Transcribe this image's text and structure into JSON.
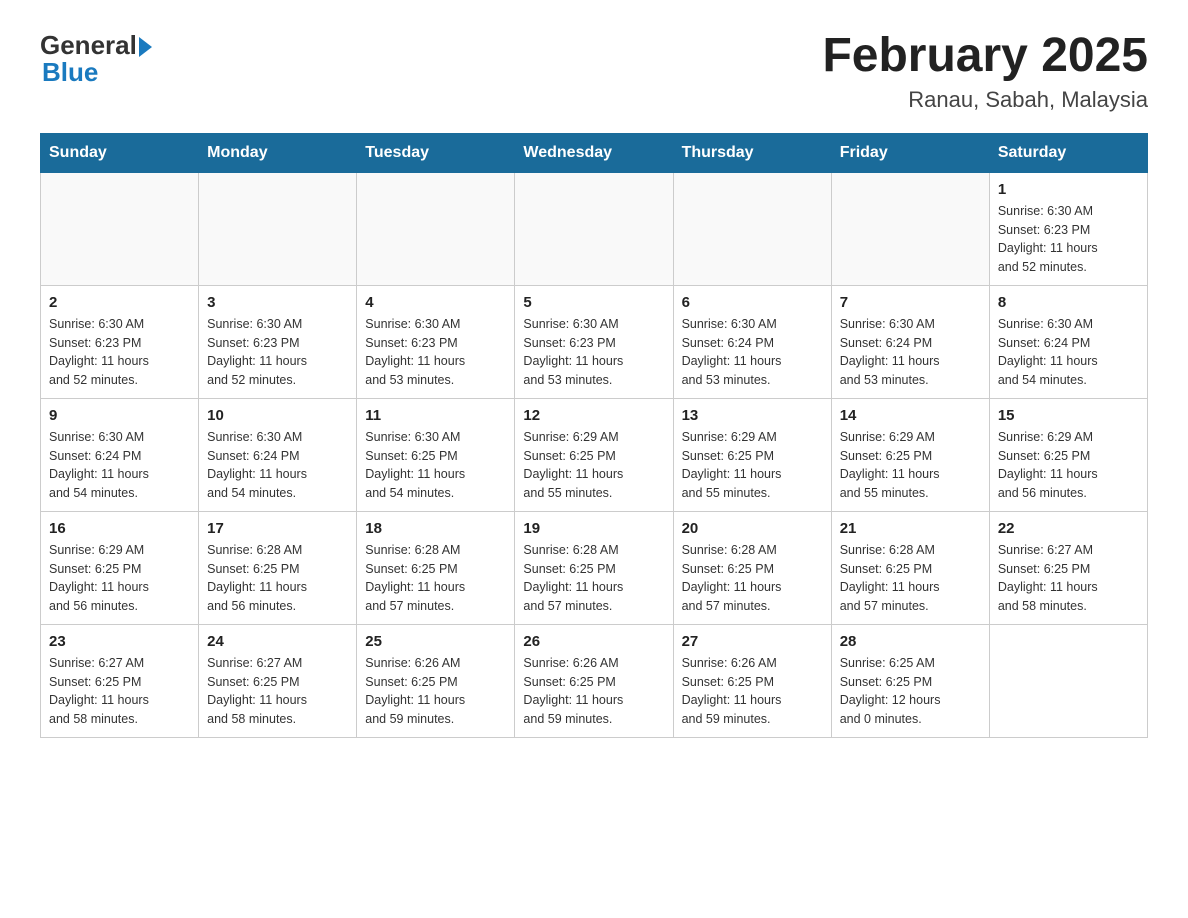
{
  "header": {
    "logo_general": "General",
    "logo_blue": "Blue",
    "month_title": "February 2025",
    "location": "Ranau, Sabah, Malaysia"
  },
  "days_of_week": [
    "Sunday",
    "Monday",
    "Tuesday",
    "Wednesday",
    "Thursday",
    "Friday",
    "Saturday"
  ],
  "weeks": [
    {
      "days": [
        {
          "date": "",
          "info": ""
        },
        {
          "date": "",
          "info": ""
        },
        {
          "date": "",
          "info": ""
        },
        {
          "date": "",
          "info": ""
        },
        {
          "date": "",
          "info": ""
        },
        {
          "date": "",
          "info": ""
        },
        {
          "date": "1",
          "info": "Sunrise: 6:30 AM\nSunset: 6:23 PM\nDaylight: 11 hours\nand 52 minutes."
        }
      ]
    },
    {
      "days": [
        {
          "date": "2",
          "info": "Sunrise: 6:30 AM\nSunset: 6:23 PM\nDaylight: 11 hours\nand 52 minutes."
        },
        {
          "date": "3",
          "info": "Sunrise: 6:30 AM\nSunset: 6:23 PM\nDaylight: 11 hours\nand 52 minutes."
        },
        {
          "date": "4",
          "info": "Sunrise: 6:30 AM\nSunset: 6:23 PM\nDaylight: 11 hours\nand 53 minutes."
        },
        {
          "date": "5",
          "info": "Sunrise: 6:30 AM\nSunset: 6:23 PM\nDaylight: 11 hours\nand 53 minutes."
        },
        {
          "date": "6",
          "info": "Sunrise: 6:30 AM\nSunset: 6:24 PM\nDaylight: 11 hours\nand 53 minutes."
        },
        {
          "date": "7",
          "info": "Sunrise: 6:30 AM\nSunset: 6:24 PM\nDaylight: 11 hours\nand 53 minutes."
        },
        {
          "date": "8",
          "info": "Sunrise: 6:30 AM\nSunset: 6:24 PM\nDaylight: 11 hours\nand 54 minutes."
        }
      ]
    },
    {
      "days": [
        {
          "date": "9",
          "info": "Sunrise: 6:30 AM\nSunset: 6:24 PM\nDaylight: 11 hours\nand 54 minutes."
        },
        {
          "date": "10",
          "info": "Sunrise: 6:30 AM\nSunset: 6:24 PM\nDaylight: 11 hours\nand 54 minutes."
        },
        {
          "date": "11",
          "info": "Sunrise: 6:30 AM\nSunset: 6:25 PM\nDaylight: 11 hours\nand 54 minutes."
        },
        {
          "date": "12",
          "info": "Sunrise: 6:29 AM\nSunset: 6:25 PM\nDaylight: 11 hours\nand 55 minutes."
        },
        {
          "date": "13",
          "info": "Sunrise: 6:29 AM\nSunset: 6:25 PM\nDaylight: 11 hours\nand 55 minutes."
        },
        {
          "date": "14",
          "info": "Sunrise: 6:29 AM\nSunset: 6:25 PM\nDaylight: 11 hours\nand 55 minutes."
        },
        {
          "date": "15",
          "info": "Sunrise: 6:29 AM\nSunset: 6:25 PM\nDaylight: 11 hours\nand 56 minutes."
        }
      ]
    },
    {
      "days": [
        {
          "date": "16",
          "info": "Sunrise: 6:29 AM\nSunset: 6:25 PM\nDaylight: 11 hours\nand 56 minutes."
        },
        {
          "date": "17",
          "info": "Sunrise: 6:28 AM\nSunset: 6:25 PM\nDaylight: 11 hours\nand 56 minutes."
        },
        {
          "date": "18",
          "info": "Sunrise: 6:28 AM\nSunset: 6:25 PM\nDaylight: 11 hours\nand 57 minutes."
        },
        {
          "date": "19",
          "info": "Sunrise: 6:28 AM\nSunset: 6:25 PM\nDaylight: 11 hours\nand 57 minutes."
        },
        {
          "date": "20",
          "info": "Sunrise: 6:28 AM\nSunset: 6:25 PM\nDaylight: 11 hours\nand 57 minutes."
        },
        {
          "date": "21",
          "info": "Sunrise: 6:28 AM\nSunset: 6:25 PM\nDaylight: 11 hours\nand 57 minutes."
        },
        {
          "date": "22",
          "info": "Sunrise: 6:27 AM\nSunset: 6:25 PM\nDaylight: 11 hours\nand 58 minutes."
        }
      ]
    },
    {
      "days": [
        {
          "date": "23",
          "info": "Sunrise: 6:27 AM\nSunset: 6:25 PM\nDaylight: 11 hours\nand 58 minutes."
        },
        {
          "date": "24",
          "info": "Sunrise: 6:27 AM\nSunset: 6:25 PM\nDaylight: 11 hours\nand 58 minutes."
        },
        {
          "date": "25",
          "info": "Sunrise: 6:26 AM\nSunset: 6:25 PM\nDaylight: 11 hours\nand 59 minutes."
        },
        {
          "date": "26",
          "info": "Sunrise: 6:26 AM\nSunset: 6:25 PM\nDaylight: 11 hours\nand 59 minutes."
        },
        {
          "date": "27",
          "info": "Sunrise: 6:26 AM\nSunset: 6:25 PM\nDaylight: 11 hours\nand 59 minutes."
        },
        {
          "date": "28",
          "info": "Sunrise: 6:25 AM\nSunset: 6:25 PM\nDaylight: 12 hours\nand 0 minutes."
        },
        {
          "date": "",
          "info": ""
        }
      ]
    }
  ]
}
